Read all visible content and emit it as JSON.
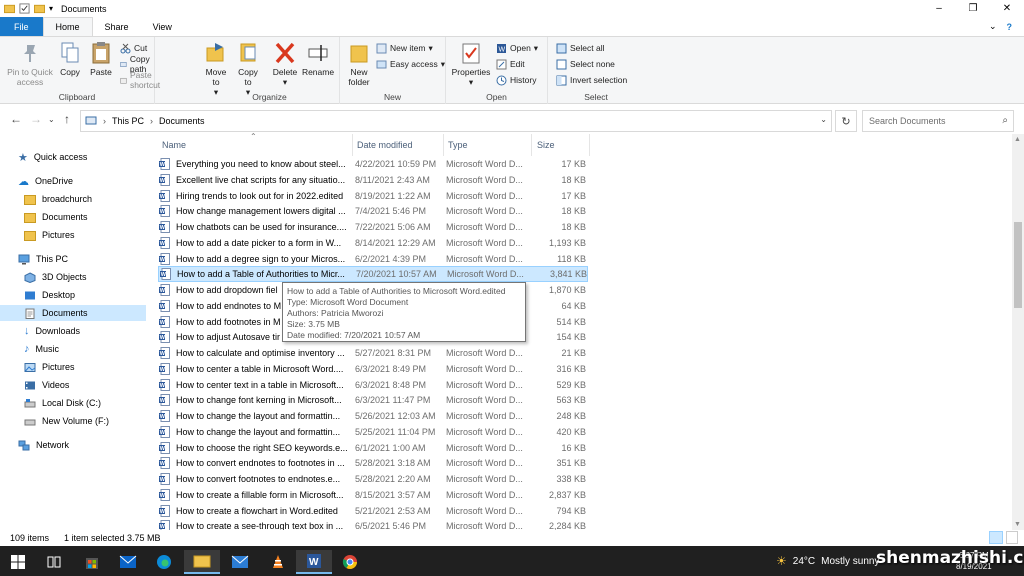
{
  "window": {
    "title": "Documents",
    "controls": [
      "–",
      "❐",
      "✕"
    ]
  },
  "tabs": {
    "file": "File",
    "home": "Home",
    "share": "Share",
    "view": "View",
    "collapse": "⌄",
    "help": "?"
  },
  "ribbon": {
    "clipboard": {
      "label": "Clipboard",
      "pin": "Pin to Quick access",
      "copy": "Copy",
      "paste": "Paste",
      "cut": "Cut",
      "copy_path": "Copy path",
      "paste_shortcut": "Paste shortcut"
    },
    "organize": {
      "label": "Organize",
      "move_to": "Move to",
      "copy_to": "Copy to",
      "delete": "Delete",
      "rename": "Rename"
    },
    "new": {
      "label": "New",
      "new_folder": "New folder",
      "new_item": "New item",
      "easy_access": "Easy access"
    },
    "open": {
      "label": "Open",
      "properties": "Properties",
      "open": "Open",
      "edit": "Edit",
      "history": "History"
    },
    "select": {
      "label": "Select",
      "select_all": "Select all",
      "select_none": "Select none",
      "invert": "Invert selection"
    }
  },
  "address": {
    "crumbs": [
      "This PC",
      "Documents"
    ],
    "search_placeholder": "Search Documents"
  },
  "nav": {
    "quick_access": "Quick access",
    "onedrive": "OneDrive",
    "broadchurch": "broadchurch",
    "documents_od": "Documents",
    "pictures_od": "Pictures",
    "this_pc": "This PC",
    "objects3d": "3D Objects",
    "desktop": "Desktop",
    "documents": "Documents",
    "downloads": "Downloads",
    "music": "Music",
    "pictures": "Pictures",
    "videos": "Videos",
    "local_disk": "Local Disk (C:)",
    "new_volume": "New Volume (F:)",
    "network": "Network"
  },
  "columns": {
    "name": "Name",
    "date": "Date modified",
    "type": "Type",
    "size": "Size"
  },
  "files": [
    {
      "name": "Everything you need to know about steel...",
      "date": "4/22/2021 10:59 PM",
      "type": "Microsoft Word D...",
      "size": "17 KB"
    },
    {
      "name": "Excellent live chat scripts for any situatio...",
      "date": "8/11/2021 2:43 AM",
      "type": "Microsoft Word D...",
      "size": "18 KB"
    },
    {
      "name": "Hiring trends to look out for in 2022.edited",
      "date": "8/19/2021 1:22 AM",
      "type": "Microsoft Word D...",
      "size": "17 KB"
    },
    {
      "name": "How change management lowers digital ...",
      "date": "7/4/2021 5:46 PM",
      "type": "Microsoft Word D...",
      "size": "18 KB"
    },
    {
      "name": "How chatbots can be used for insurance....",
      "date": "7/22/2021 5:06 AM",
      "type": "Microsoft Word D...",
      "size": "18 KB"
    },
    {
      "name": "How to add a date picker to a form in W...",
      "date": "8/14/2021 12:29 AM",
      "type": "Microsoft Word D...",
      "size": "1,193 KB"
    },
    {
      "name": "How to add a degree sign to your Micros...",
      "date": "6/2/2021 4:39 PM",
      "type": "Microsoft Word D...",
      "size": "118 KB"
    },
    {
      "name": "How to add a Table of Authorities to Micr...",
      "date": "7/20/2021 10:57 AM",
      "type": "Microsoft Word D...",
      "size": "3,841 KB"
    },
    {
      "name": "How to add dropdown fiel",
      "date": "",
      "type": "",
      "size": "1,870 KB"
    },
    {
      "name": "How to add endnotes to M",
      "date": "",
      "type": "",
      "size": "64 KB"
    },
    {
      "name": "How to add footnotes in M",
      "date": "",
      "type": "",
      "size": "514 KB"
    },
    {
      "name": "How to adjust Autosave tir",
      "date": "",
      "type": "",
      "size": "154 KB"
    },
    {
      "name": "How to calculate and optimise inventory ...",
      "date": "5/27/2021 8:31 PM",
      "type": "Microsoft Word D...",
      "size": "21 KB"
    },
    {
      "name": "How to center a table in Microsoft Word....",
      "date": "6/3/2021 8:49 PM",
      "type": "Microsoft Word D...",
      "size": "316 KB"
    },
    {
      "name": "How to center text in a table in Microsoft...",
      "date": "6/3/2021 8:48 PM",
      "type": "Microsoft Word D...",
      "size": "529 KB"
    },
    {
      "name": "How to change font kerning in Microsoft...",
      "date": "6/3/2021 11:47 PM",
      "type": "Microsoft Word D...",
      "size": "563 KB"
    },
    {
      "name": "How to change the layout and formattin...",
      "date": "5/26/2021 12:03 AM",
      "type": "Microsoft Word D...",
      "size": "248 KB"
    },
    {
      "name": "How to change the layout and formattin...",
      "date": "5/25/2021 11:04 PM",
      "type": "Microsoft Word D...",
      "size": "420 KB"
    },
    {
      "name": "How to choose the right SEO keywords.e...",
      "date": "6/1/2021 1:00 AM",
      "type": "Microsoft Word D...",
      "size": "16 KB"
    },
    {
      "name": "How to convert endnotes to footnotes in ...",
      "date": "5/28/2021 3:18 AM",
      "type": "Microsoft Word D...",
      "size": "351 KB"
    },
    {
      "name": "How to convert footnotes to endnotes.e...",
      "date": "5/28/2021 2:20 AM",
      "type": "Microsoft Word D...",
      "size": "338 KB"
    },
    {
      "name": "How to create a fillable form in Microsoft...",
      "date": "8/15/2021 3:57 AM",
      "type": "Microsoft Word D...",
      "size": "2,837 KB"
    },
    {
      "name": "How to create a flowchart in Word.edited",
      "date": "5/21/2021 2:53 AM",
      "type": "Microsoft Word D...",
      "size": "794 KB"
    },
    {
      "name": "How to create a see-through text box in ...",
      "date": "6/5/2021 5:46 PM",
      "type": "Microsoft Word D...",
      "size": "2,284 KB"
    }
  ],
  "tooltip": {
    "line1": "How to add a Table of Authorities to Microsoft Word.edited",
    "line2": "Type: Microsoft Word Document",
    "line3": "Authors: Patricia Mworozi",
    "line4": "Size: 3.75 MB",
    "line5": "Date modified: 7/20/2021 10:57 AM"
  },
  "status": {
    "count": "109 items",
    "selected": "1 item selected  3.75 MB"
  },
  "taskbar": {
    "temperature": "24°C",
    "weather": "Mostly sunny",
    "time": "6:27 PM",
    "date": "8/19/2021",
    "watermark": "shenmazhishi.com"
  },
  "colors": {
    "accent": "#1979ca",
    "selection": "#cce8ff",
    "taskbar": "#202020"
  }
}
